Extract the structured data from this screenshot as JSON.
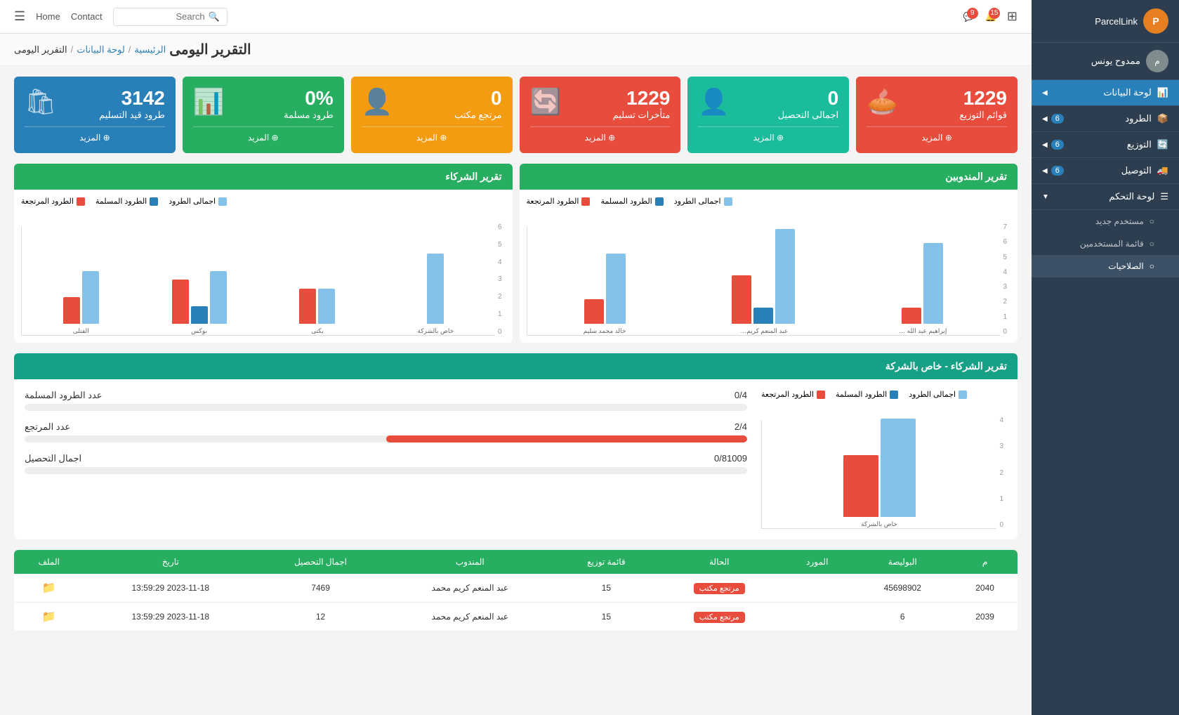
{
  "brand": {
    "name": "ParcelLink",
    "avatar_text": "P"
  },
  "user": {
    "name": "ممدوح يونس",
    "avatar_text": "م"
  },
  "topnav": {
    "notifications_count": "15",
    "messages_count": "9",
    "search_placeholder": "Search",
    "contact_label": "Contact",
    "home_label": "Home"
  },
  "breadcrumb": {
    "home": "الرئيسية",
    "dashboard": "لوحة البيانات",
    "current": "التقرير اليومى"
  },
  "page_title": "التقرير اليومى",
  "stat_cards": [
    {
      "number": "3142",
      "label": "طرود قيد التسليم",
      "color": "card-blue",
      "icon": "🛍",
      "more_label": "المزيد"
    },
    {
      "number": "0%",
      "label": "طرود مسلمة",
      "color": "card-green",
      "icon": "📊",
      "more_label": "المزيد"
    },
    {
      "number": "0",
      "label": "مرتجع مكتب",
      "color": "card-orange",
      "icon": "👤",
      "more_label": "المزيد"
    },
    {
      "number": "1229",
      "label": "متأخرات تسليم",
      "color": "card-red",
      "icon": "🔄",
      "more_label": "المزيد"
    },
    {
      "number": "0",
      "label": "اجمالى التحصيل",
      "color": "card-teal",
      "icon": "👤",
      "more_label": "المزيد"
    },
    {
      "number": "1229",
      "label": "قوائم التوزيع",
      "color": "card-red",
      "icon": "🥧",
      "more_label": "المزيد"
    }
  ],
  "delegates_report": {
    "title": "تقرير المندوبين",
    "legend": [
      {
        "label": "الطرود المرتجعة",
        "color": "#e74c3c"
      },
      {
        "label": "الطرود المسلمة",
        "color": "#2980b9"
      },
      {
        "label": "اجمالى الطرود",
        "color": "#85c1e9"
      }
    ],
    "y_axis": [
      "7",
      "6",
      "5",
      "4",
      "3",
      "2",
      "1",
      "0"
    ],
    "bars": [
      {
        "label": "إبراهيم عبد الله محمد",
        "total": 5,
        "delivered": 0,
        "returned": 1
      },
      {
        "label": "عبد المنعم كريم محمد",
        "total": 6,
        "delivered": 1,
        "returned": 3
      },
      {
        "label": "خالد محمد سليم",
        "total": 4.5,
        "delivered": 0,
        "returned": 1.5
      }
    ]
  },
  "partners_report": {
    "title": "تقرير الشركاء",
    "legend": [
      {
        "label": "الطرود المرتجعة",
        "color": "#e74c3c"
      },
      {
        "label": "الطرود المسلمة",
        "color": "#2980b9"
      },
      {
        "label": "اجمالى الطرود",
        "color": "#85c1e9"
      }
    ],
    "y_axis": [
      "6",
      "5",
      "4",
      "3",
      "2",
      "1",
      "0"
    ],
    "bars": [
      {
        "label": "خاص بالشركة",
        "total": 4,
        "delivered": 0,
        "returned": 0
      },
      {
        "label": "بكتى",
        "total": 2,
        "delivered": 0,
        "returned": 2
      },
      {
        "label": "بوكس",
        "total": 3,
        "delivered": 1,
        "returned": 2.5
      },
      {
        "label": "الفتلى",
        "total": 3,
        "delivered": 0,
        "returned": 1.5
      }
    ]
  },
  "company_report": {
    "title": "تقرير الشركاء - خاص بالشركة",
    "legend": [
      {
        "label": "الطرود المرتجعة",
        "color": "#e74c3c"
      },
      {
        "label": "الطرود المسلمة",
        "color": "#2980b9"
      },
      {
        "label": "اجمالى الطرود",
        "color": "#85c1e9"
      }
    ],
    "y_axis": [
      "4",
      "3",
      "2",
      "1",
      "0"
    ],
    "bar_label": "خاص بالشركة",
    "bar_total": 4,
    "bar_returned": 2.5,
    "stats": [
      {
        "label": "عدد الطرود المسلمة",
        "value": "0/4",
        "percent": 0,
        "color": "#85c1e9"
      },
      {
        "label": "عدد المرتجع",
        "value": "2/4",
        "percent": 50,
        "color": "#e74c3c"
      },
      {
        "label": "اجمال التحصيل",
        "value": "0/81009",
        "percent": 0,
        "color": "#85c1e9"
      }
    ]
  },
  "table": {
    "columns": [
      "م",
      "البوليصة",
      "المورد",
      "الحالة",
      "قائمة توزيع",
      "المندوب",
      "اجمال التحصيل",
      "تاريخ",
      "الملف"
    ],
    "rows": [
      {
        "id": "2040",
        "waybill": "45698902",
        "supplier": "",
        "status": "مرتجع مكتب",
        "status_color": "badge-returned",
        "distribution_list": "15",
        "delegate": "عبد المنعم كريم محمد",
        "total": "7469",
        "date": "2023-11-18 13:59:29",
        "has_file": true
      },
      {
        "id": "2039",
        "waybill": "6",
        "supplier": "",
        "status": "مرتجع مكتب",
        "status_color": "badge-returned",
        "distribution_list": "15",
        "delegate": "عبد المنعم كريم محمد",
        "total": "12",
        "date": "2023-11-18 13:59:29",
        "has_file": true
      }
    ]
  },
  "sidebar": {
    "items": [
      {
        "label": "لوحة البيانات",
        "icon": "📊",
        "active": true,
        "badge": null
      },
      {
        "label": "الطرود",
        "icon": "📦",
        "active": false,
        "badge": "6"
      },
      {
        "label": "التوزيع",
        "icon": "🔄",
        "active": false,
        "badge": "6"
      },
      {
        "label": "التوصيل",
        "icon": "🚚",
        "active": false,
        "badge": "6"
      },
      {
        "label": "لوحة التحكم",
        "icon": "⚙",
        "active": false,
        "badge": null,
        "expanded": true
      }
    ],
    "sub_items": [
      {
        "label": "مستخدم جديد"
      },
      {
        "label": "قائمة المستخدمين"
      },
      {
        "label": "الصلاحيات",
        "active": true
      }
    ]
  }
}
